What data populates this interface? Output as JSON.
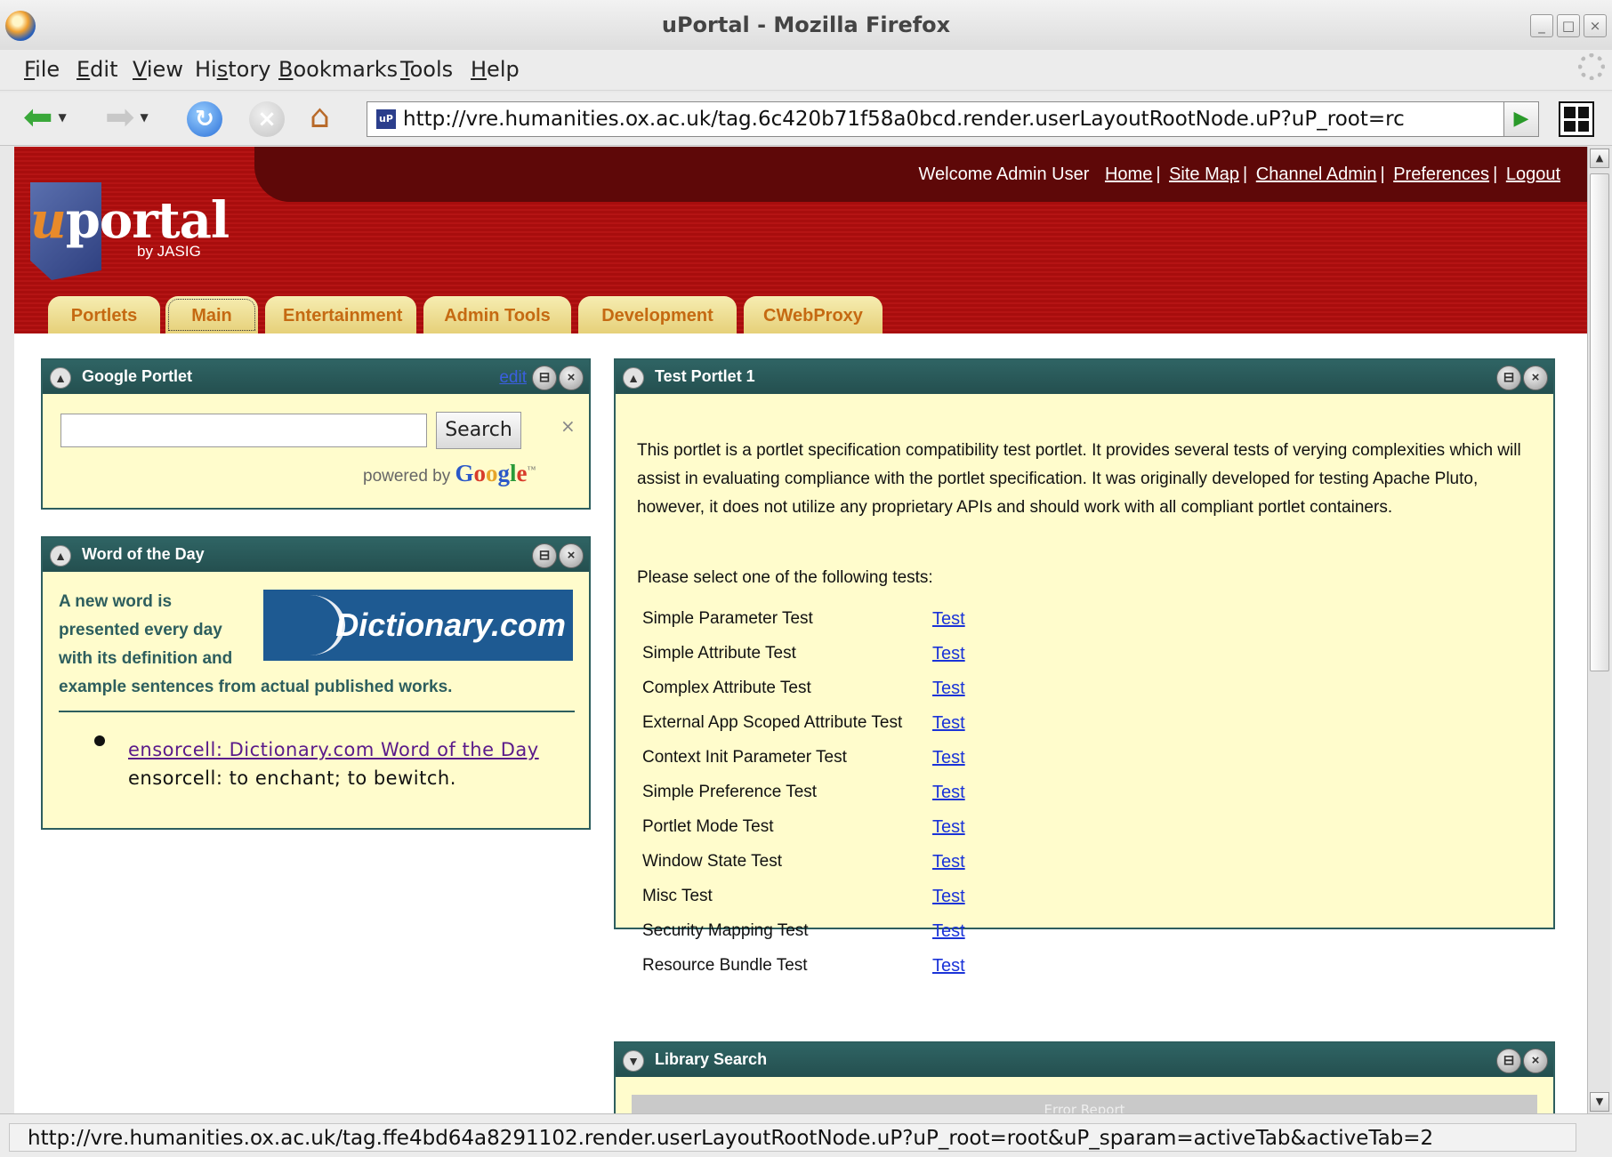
{
  "window": {
    "title": "uPortal - Mozilla Firefox",
    "controls": [
      "_",
      "□",
      "×"
    ]
  },
  "menubar": {
    "items": [
      {
        "pre": "",
        "u": "F",
        "post": "ile"
      },
      {
        "pre": "",
        "u": "E",
        "post": "dit"
      },
      {
        "pre": "",
        "u": "V",
        "post": "iew"
      },
      {
        "pre": "Hi",
        "u": "s",
        "post": "tory"
      },
      {
        "pre": "",
        "u": "B",
        "post": "ookmarks"
      },
      {
        "pre": "",
        "u": "T",
        "post": "ools"
      },
      {
        "pre": "",
        "u": "H",
        "post": "elp"
      }
    ]
  },
  "navbar": {
    "url": "http://vre.humanities.ox.ac.uk/tag.6c420b71f58a0bcd.render.userLayoutRootNode.uP?uP_root=rc",
    "favicon_text": "uP"
  },
  "header": {
    "greeting": "Welcome Admin User",
    "links": [
      "Home",
      "Site Map",
      "Channel Admin",
      "Preferences",
      "Logout"
    ],
    "logo_u": "u",
    "logo_rest": "portal",
    "logo_sub": "by JASIG"
  },
  "tabs": [
    "Portlets",
    "Main",
    "Entertainment",
    "Admin Tools",
    "Development",
    "CWebProxy"
  ],
  "google_portlet": {
    "title": "Google Portlet",
    "edit_label": "edit",
    "search_value": "",
    "search_button": "Search",
    "clear": "×",
    "powered_by": "powered by",
    "google": {
      "G": "G",
      "o1": "o",
      "o2": "o",
      "g": "g",
      "l": "l",
      "e": "e",
      "tm": "™"
    }
  },
  "wotd_portlet": {
    "title": "Word of the Day",
    "description": "A new word is presented every day with its definition and example sentences from actual published works.",
    "desc_lines": [
      "A new word is",
      "presented every day",
      "with its definition and",
      "example sentences from actual published works."
    ],
    "logo_text": "Dictionary.com",
    "link_text": "ensorcell: Dictionary.com Word of the Day",
    "definition": "ensorcell: to enchant; to bewitch."
  },
  "test_portlet": {
    "title": "Test Portlet 1",
    "intro": "This portlet is a portlet specification compatibility test portlet. It provides several tests of verying complexities which will assist in evaluating compliance with the portlet specification. It was originally developed for testing Apache Pluto, however, it does not utilize any proprietary APIs and should work with all compliant portlet containers.",
    "prompt": "Please select one of the following tests:",
    "tests": [
      {
        "name": "Simple Parameter Test",
        "link": "Test"
      },
      {
        "name": "Simple Attribute Test",
        "link": "Test"
      },
      {
        "name": "Complex Attribute Test",
        "link": "Test"
      },
      {
        "name": "External App Scoped Attribute Test",
        "link": "Test"
      },
      {
        "name": "Context Init Parameter Test",
        "link": "Test"
      },
      {
        "name": "Simple Preference Test",
        "link": "Test"
      },
      {
        "name": "Portlet Mode Test",
        "link": "Test"
      },
      {
        "name": "Window State Test",
        "link": "Test"
      },
      {
        "name": "Misc Test",
        "link": "Test"
      },
      {
        "name": "Security Mapping Test",
        "link": "Test"
      },
      {
        "name": "Resource Bundle Test",
        "link": "Test"
      }
    ]
  },
  "library_portlet": {
    "title": "Library Search",
    "inner_text": "Error Report"
  },
  "statusbar": {
    "text": "http://vre.humanities.ox.ac.uk/tag.ffe4bd64a8291102.render.userLayoutRootNode.uP?uP_root=root&uP_sparam=activeTab&activeTab=2"
  },
  "colors": {
    "header_red": "#b51414",
    "header_dark": "#5e0808",
    "portlet_bar": "#2f6464",
    "portlet_bg": "#fffccc",
    "tab_text": "#c56a12",
    "link_blue": "#1a33d8"
  }
}
